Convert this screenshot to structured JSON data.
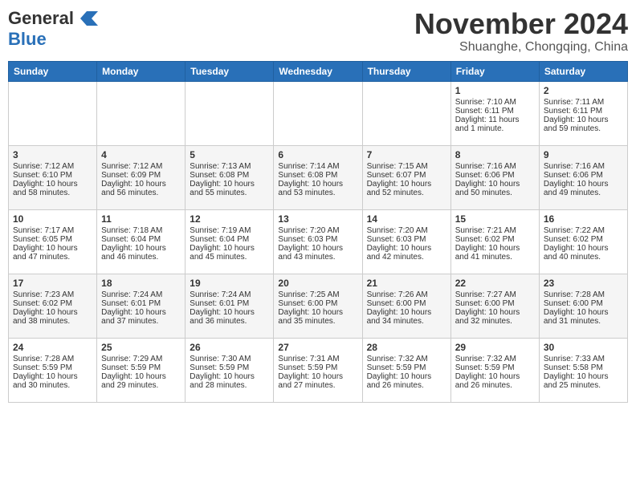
{
  "header": {
    "logo_general": "General",
    "logo_blue": "Blue",
    "month": "November 2024",
    "location": "Shuanghe, Chongqing, China"
  },
  "weekdays": [
    "Sunday",
    "Monday",
    "Tuesday",
    "Wednesday",
    "Thursday",
    "Friday",
    "Saturday"
  ],
  "weeks": [
    [
      {
        "day": "",
        "content": ""
      },
      {
        "day": "",
        "content": ""
      },
      {
        "day": "",
        "content": ""
      },
      {
        "day": "",
        "content": ""
      },
      {
        "day": "",
        "content": ""
      },
      {
        "day": "1",
        "content": "Sunrise: 7:10 AM\nSunset: 6:11 PM\nDaylight: 11 hours\nand 1 minute."
      },
      {
        "day": "2",
        "content": "Sunrise: 7:11 AM\nSunset: 6:11 PM\nDaylight: 10 hours\nand 59 minutes."
      }
    ],
    [
      {
        "day": "3",
        "content": "Sunrise: 7:12 AM\nSunset: 6:10 PM\nDaylight: 10 hours\nand 58 minutes."
      },
      {
        "day": "4",
        "content": "Sunrise: 7:12 AM\nSunset: 6:09 PM\nDaylight: 10 hours\nand 56 minutes."
      },
      {
        "day": "5",
        "content": "Sunrise: 7:13 AM\nSunset: 6:08 PM\nDaylight: 10 hours\nand 55 minutes."
      },
      {
        "day": "6",
        "content": "Sunrise: 7:14 AM\nSunset: 6:08 PM\nDaylight: 10 hours\nand 53 minutes."
      },
      {
        "day": "7",
        "content": "Sunrise: 7:15 AM\nSunset: 6:07 PM\nDaylight: 10 hours\nand 52 minutes."
      },
      {
        "day": "8",
        "content": "Sunrise: 7:16 AM\nSunset: 6:06 PM\nDaylight: 10 hours\nand 50 minutes."
      },
      {
        "day": "9",
        "content": "Sunrise: 7:16 AM\nSunset: 6:06 PM\nDaylight: 10 hours\nand 49 minutes."
      }
    ],
    [
      {
        "day": "10",
        "content": "Sunrise: 7:17 AM\nSunset: 6:05 PM\nDaylight: 10 hours\nand 47 minutes."
      },
      {
        "day": "11",
        "content": "Sunrise: 7:18 AM\nSunset: 6:04 PM\nDaylight: 10 hours\nand 46 minutes."
      },
      {
        "day": "12",
        "content": "Sunrise: 7:19 AM\nSunset: 6:04 PM\nDaylight: 10 hours\nand 45 minutes."
      },
      {
        "day": "13",
        "content": "Sunrise: 7:20 AM\nSunset: 6:03 PM\nDaylight: 10 hours\nand 43 minutes."
      },
      {
        "day": "14",
        "content": "Sunrise: 7:20 AM\nSunset: 6:03 PM\nDaylight: 10 hours\nand 42 minutes."
      },
      {
        "day": "15",
        "content": "Sunrise: 7:21 AM\nSunset: 6:02 PM\nDaylight: 10 hours\nand 41 minutes."
      },
      {
        "day": "16",
        "content": "Sunrise: 7:22 AM\nSunset: 6:02 PM\nDaylight: 10 hours\nand 40 minutes."
      }
    ],
    [
      {
        "day": "17",
        "content": "Sunrise: 7:23 AM\nSunset: 6:02 PM\nDaylight: 10 hours\nand 38 minutes."
      },
      {
        "day": "18",
        "content": "Sunrise: 7:24 AM\nSunset: 6:01 PM\nDaylight: 10 hours\nand 37 minutes."
      },
      {
        "day": "19",
        "content": "Sunrise: 7:24 AM\nSunset: 6:01 PM\nDaylight: 10 hours\nand 36 minutes."
      },
      {
        "day": "20",
        "content": "Sunrise: 7:25 AM\nSunset: 6:00 PM\nDaylight: 10 hours\nand 35 minutes."
      },
      {
        "day": "21",
        "content": "Sunrise: 7:26 AM\nSunset: 6:00 PM\nDaylight: 10 hours\nand 34 minutes."
      },
      {
        "day": "22",
        "content": "Sunrise: 7:27 AM\nSunset: 6:00 PM\nDaylight: 10 hours\nand 32 minutes."
      },
      {
        "day": "23",
        "content": "Sunrise: 7:28 AM\nSunset: 6:00 PM\nDaylight: 10 hours\nand 31 minutes."
      }
    ],
    [
      {
        "day": "24",
        "content": "Sunrise: 7:28 AM\nSunset: 5:59 PM\nDaylight: 10 hours\nand 30 minutes."
      },
      {
        "day": "25",
        "content": "Sunrise: 7:29 AM\nSunset: 5:59 PM\nDaylight: 10 hours\nand 29 minutes."
      },
      {
        "day": "26",
        "content": "Sunrise: 7:30 AM\nSunset: 5:59 PM\nDaylight: 10 hours\nand 28 minutes."
      },
      {
        "day": "27",
        "content": "Sunrise: 7:31 AM\nSunset: 5:59 PM\nDaylight: 10 hours\nand 27 minutes."
      },
      {
        "day": "28",
        "content": "Sunrise: 7:32 AM\nSunset: 5:59 PM\nDaylight: 10 hours\nand 26 minutes."
      },
      {
        "day": "29",
        "content": "Sunrise: 7:32 AM\nSunset: 5:59 PM\nDaylight: 10 hours\nand 26 minutes."
      },
      {
        "day": "30",
        "content": "Sunrise: 7:33 AM\nSunset: 5:58 PM\nDaylight: 10 hours\nand 25 minutes."
      }
    ]
  ]
}
